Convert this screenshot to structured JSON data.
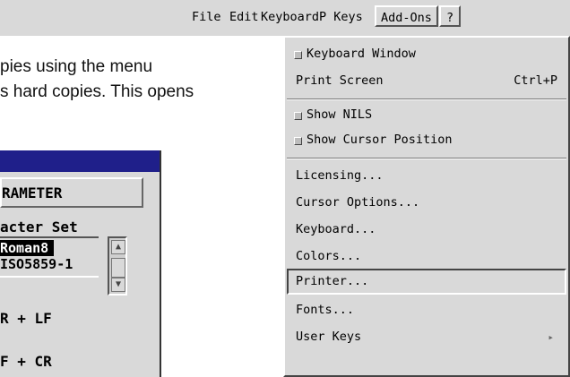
{
  "menubar": {
    "items": [
      {
        "label": "File"
      },
      {
        "label": "Edit"
      },
      {
        "label": "Keyboard"
      },
      {
        "label": "P Keys"
      },
      {
        "label": "Add-Ons"
      },
      {
        "label": "?"
      }
    ]
  },
  "document": {
    "line1": "pies using the menu",
    "line2": "s hard copies. This opens"
  },
  "dialog": {
    "header": "RAMETER",
    "charset_label": "acter Set",
    "charset_options": [
      "Roman8",
      "ISO5859-1"
    ],
    "option_cr_lf": "R + LF",
    "option_lf_cr": "F + CR"
  },
  "addons_menu": {
    "items": [
      {
        "label": "Keyboard Window",
        "accel": "",
        "check": true
      },
      {
        "label": "Print Screen",
        "accel": "Ctrl+P"
      },
      {
        "label": "Show NILS",
        "check": true
      },
      {
        "label": "Show Cursor Position",
        "check": true
      },
      {
        "label": "Licensing..."
      },
      {
        "label": "Cursor Options..."
      },
      {
        "label": "Keyboard..."
      },
      {
        "label": "Colors..."
      },
      {
        "label": "Printer..."
      },
      {
        "label": "Fonts..."
      },
      {
        "label": "User Keys"
      }
    ],
    "submenu_arrow": "▸"
  }
}
